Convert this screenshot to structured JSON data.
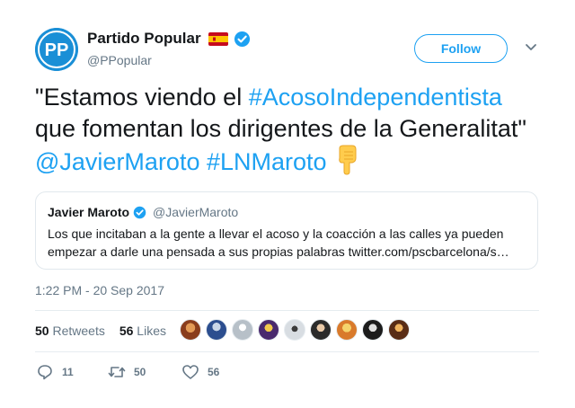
{
  "author": {
    "display_name": "Partido Popular",
    "handle": "@PPopular",
    "avatar_initials": "PP",
    "brand_color": "#1a8fd6"
  },
  "follow_label": "Follow",
  "tweet": {
    "line1_text": "\"Estamos viendo el ",
    "line1_hashtag": "#AcosoIndependentista",
    "line2_text": "que fomentan los dirigentes de la Generalitat\"",
    "line3_mention": "@JavierMaroto",
    "line3_hashtag": "#LNMaroto"
  },
  "quote": {
    "name": "Javier Maroto",
    "handle": "@JavierMaroto",
    "line1": "Los que incitaban a la gente a llevar el acoso y la coacción a las calles ya pueden",
    "line2": "empezar a darle una pensada a sus propias palabras twitter.com/pscbarcelona/s…"
  },
  "timestamp": "1:22 PM - 20 Sep 2017",
  "stats": {
    "retweets_count": "50",
    "retweets_label": "Retweets",
    "likes_count": "56",
    "likes_label": "Likes"
  },
  "action_counts": {
    "replies": "11",
    "retweets": "50",
    "likes": "56"
  },
  "colors": {
    "accent": "#1da1f2",
    "text": "#14171a",
    "muted": "#657786",
    "border": "#e1e8ed"
  }
}
